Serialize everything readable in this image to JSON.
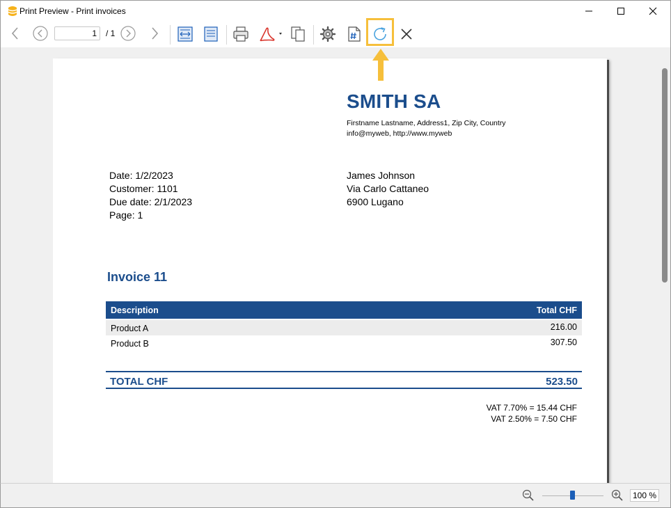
{
  "window": {
    "title": "Print Preview - Print invoices"
  },
  "toolbar": {
    "page_value": "1",
    "page_total": "/ 1",
    "icons": [
      "back-arrow-icon",
      "prev-page-icon",
      "next-page-icon",
      "forward-arrow-icon",
      "fit-width-icon",
      "fit-page-icon",
      "print-icon",
      "pdf-icon",
      "copy-icon",
      "settings-icon",
      "page-number-icon",
      "refresh-icon",
      "close-icon"
    ],
    "highlight_color": "#f6bf3b"
  },
  "invoice": {
    "company": "SMITH SA",
    "company_address_line1": "Firstname Lastname, Address1, Zip City, Country",
    "company_address_line2": "info@myweb, http://www.myweb",
    "date": "Date: 1/2/2023",
    "customer": "Customer: 1101",
    "due_date": "Due date: 2/1/2023",
    "page": "Page: 1",
    "recipient_name": "James Johnson",
    "recipient_street": "Via Carlo Cattaneo",
    "recipient_city": "6900 Lugano",
    "title": "Invoice 11",
    "table": {
      "col_description": "Description",
      "col_total": "Total CHF",
      "rows": [
        {
          "description": "Product A",
          "total": "216.00"
        },
        {
          "description": "Product B",
          "total": "307.50"
        }
      ]
    },
    "total_label": "TOTAL CHF",
    "total_value": "523.50",
    "vat_line1": "VAT 7.70% = 15.44 CHF",
    "vat_line2": "VAT 2.50% = 7.50 CHF",
    "accent_color": "#1b4d8c"
  },
  "statusbar": {
    "zoom": "100 %"
  }
}
